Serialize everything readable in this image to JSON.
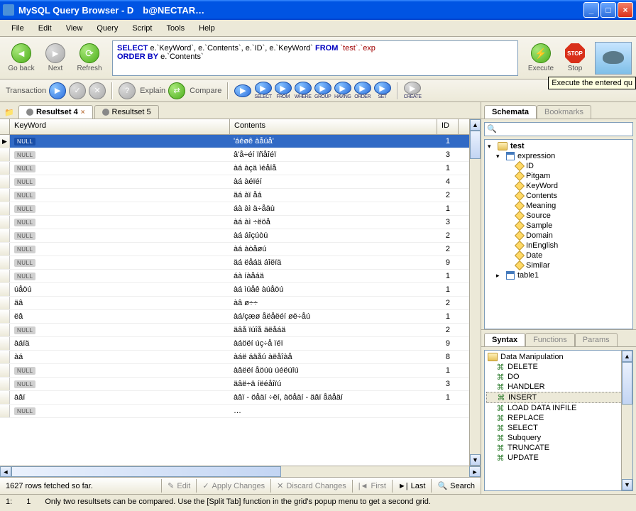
{
  "window": {
    "title": "MySQL Query Browser - D b@NECTAR…"
  },
  "menubar": [
    "File",
    "Edit",
    "View",
    "Query",
    "Script",
    "Tools",
    "Help"
  ],
  "toolbar": {
    "goback": "Go back",
    "next": "Next",
    "refresh": "Refresh",
    "execute": "Execute",
    "stop": "Stop",
    "tooltip": "Execute the entered qu"
  },
  "query": {
    "line1_pre": "SELECT",
    "line1_mid": " e.`KeyWord`, e.`Contents`, e.`ID`, e.`KeyWord` ",
    "line1_from": "FROM",
    "line1_post": " `test`.`exp",
    "line2_pre": "ORDER BY",
    "line2_post": " e.`Contents`"
  },
  "toolbar2": {
    "transaction": "Transaction",
    "explain": "Explain",
    "compare": "Compare",
    "sqlbtns": [
      "",
      "SELECT",
      "FROM",
      "WHERE",
      "GROUP",
      "HAVING",
      "ORDER",
      "SET",
      "CREATE"
    ]
  },
  "tabs": {
    "active": "Resultset 4",
    "inactive": "Resultset 5"
  },
  "grid": {
    "headers": {
      "keyword": "KeyWord",
      "contents": "Contents",
      "id": "ID"
    },
    "rows": [
      {
        "kw": null,
        "ct": "'áéøê àåúå'",
        "id": "1"
      },
      {
        "kw": null,
        "ct": "â'å÷éí ïñåîéï",
        "id": "3"
      },
      {
        "kw": null,
        "ct": "àá àçä ìéåîå",
        "id": "1"
      },
      {
        "kw": null,
        "ct": "àá àéïéí",
        "id": "4"
      },
      {
        "kw": null,
        "ct": "äá àï åá",
        "id": "2"
      },
      {
        "kw": null,
        "ct": "áà àì ä÷åäù",
        "id": "1"
      },
      {
        "kw": null,
        "ct": "àá àì ÷ëöå",
        "id": "3"
      },
      {
        "kw": null,
        "ct": "àá áîçúòú",
        "id": "2"
      },
      {
        "kw": null,
        "ct": "àá àòåøú",
        "id": "2"
      },
      {
        "kw": null,
        "ct": "äá ëåáä áîëïä",
        "id": "9"
      },
      {
        "kw": null,
        "ct": "áà íàåáä",
        "id": "1"
      },
      {
        "kw": "úåöú",
        "ct": "àá ìúåê àúåöú",
        "id": "1"
      },
      {
        "kw": "äâ",
        "ct": "àâ ø÷÷",
        "id": "2"
      },
      {
        "kw": "ëâ",
        "ct": "àá/çæø åëåëéí øë÷åú",
        "id": "1"
      },
      {
        "kw": null,
        "ct": "äâå ïúîå äëåáä",
        "id": "2"
      },
      {
        "kw": "àáïä",
        "ct": "àáöëí úç÷å ïéï",
        "id": "9"
      },
      {
        "kw": "àá",
        "ct": "àáë áäåú àëåîàå",
        "id": "8"
      },
      {
        "kw": null,
        "ct": "àâëëí åöúù úéëúîú",
        "id": "1"
      },
      {
        "kw": null,
        "ct": "äâë÷ä íëéåîïú",
        "id": "3"
      },
      {
        "kw": "àâï",
        "ct": "àâï - öåäí ÷ëí, àöåäí - äâï åäåäí",
        "id": "1"
      },
      {
        "kw": null,
        "ct": "…",
        "id": ""
      }
    ]
  },
  "gridfooter": {
    "status": "1627 rows fetched so far.",
    "edit": "Edit",
    "apply": "Apply Changes",
    "discard": "Discard Changes",
    "first": "First",
    "last": "Last",
    "search": "Search"
  },
  "statusbar": {
    "a": "1:",
    "b": "1",
    "msg": "Only two resultsets can be compared. Use the [Split Tab] function in the grid's popup menu to get a second grid."
  },
  "schemata": {
    "tab_schemata": "Schemata",
    "tab_bookmarks": "Bookmarks",
    "db": "test",
    "table": "expression",
    "columns": [
      "ID",
      "Pitgam",
      "KeyWord",
      "Contents",
      "Meaning",
      "Source",
      "Sample",
      "Domain",
      "InEnglish",
      "Date",
      "Similar"
    ],
    "table2": "table1"
  },
  "syntax": {
    "tab_syntax": "Syntax",
    "tab_functions": "Functions",
    "tab_params": "Params",
    "group": "Data Manipulation",
    "items": [
      "DELETE",
      "DO",
      "HANDLER",
      "INSERT",
      "LOAD DATA INFILE",
      "REPLACE",
      "SELECT",
      "Subquery",
      "TRUNCATE",
      "UPDATE"
    ],
    "selected": "INSERT"
  }
}
